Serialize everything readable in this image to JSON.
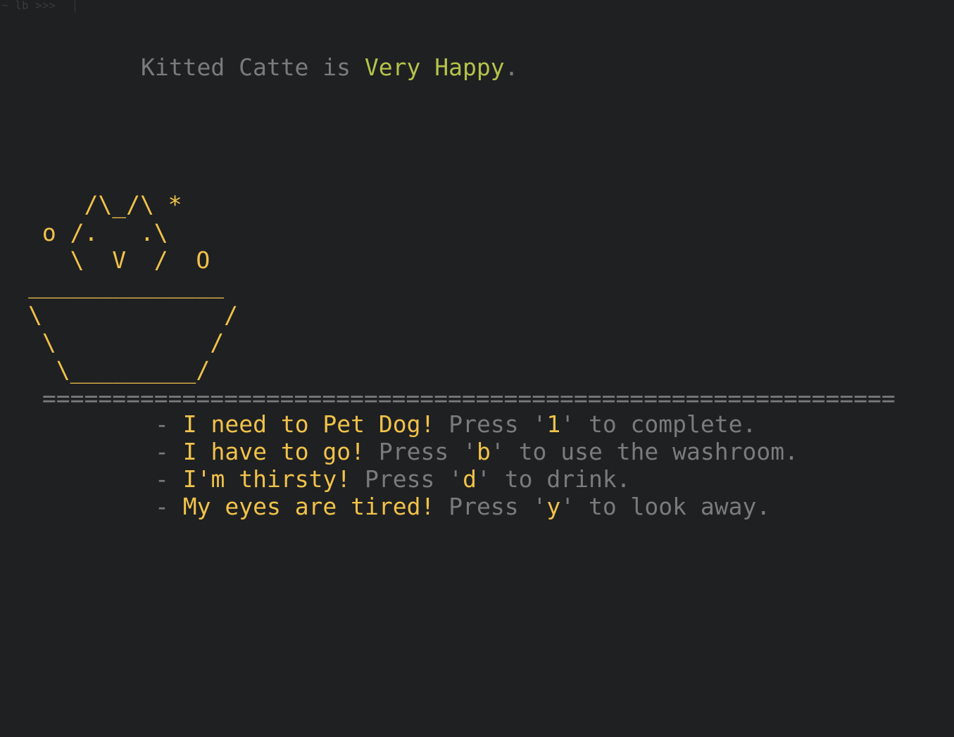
{
  "prompt": {
    "text": "~ lb >>>"
  },
  "status": {
    "pet_name": "Kitted Catte",
    "is_word": "is",
    "mood": "Very Happy",
    "period": "."
  },
  "ascii_art": {
    "lines": [
      "    /\\_/\\ *",
      " o /.   .\\",
      "   \\  V  /  O",
      "______________",
      "\\             /",
      " \\           /",
      "  \\_________/",
      " ============================================================="
    ]
  },
  "tasks": [
    {
      "dash": "- ",
      "need": "I need to Pet Dog!",
      "press_word": " Press ",
      "quote_open": "'",
      "key": "1",
      "quote_close": "'",
      "action": " to complete."
    },
    {
      "dash": "- ",
      "need": "I have to go!",
      "press_word": " Press ",
      "quote_open": "'",
      "key": "b",
      "quote_close": "'",
      "action": " to use the washroom."
    },
    {
      "dash": "- ",
      "need": "I'm thirsty!",
      "press_word": " Press ",
      "quote_open": "'",
      "key": "d",
      "quote_close": "'",
      "action": " to drink."
    },
    {
      "dash": "- ",
      "need": "My eyes are tired!",
      "press_word": " Press ",
      "quote_open": "'",
      "key": "y",
      "quote_close": "'",
      "action": " to look away."
    }
  ],
  "colors": {
    "background": "#1f2022",
    "text_gray": "#7b7b7b",
    "accent_yellow": "#f0c24a",
    "mood_green": "#b5c34a"
  }
}
